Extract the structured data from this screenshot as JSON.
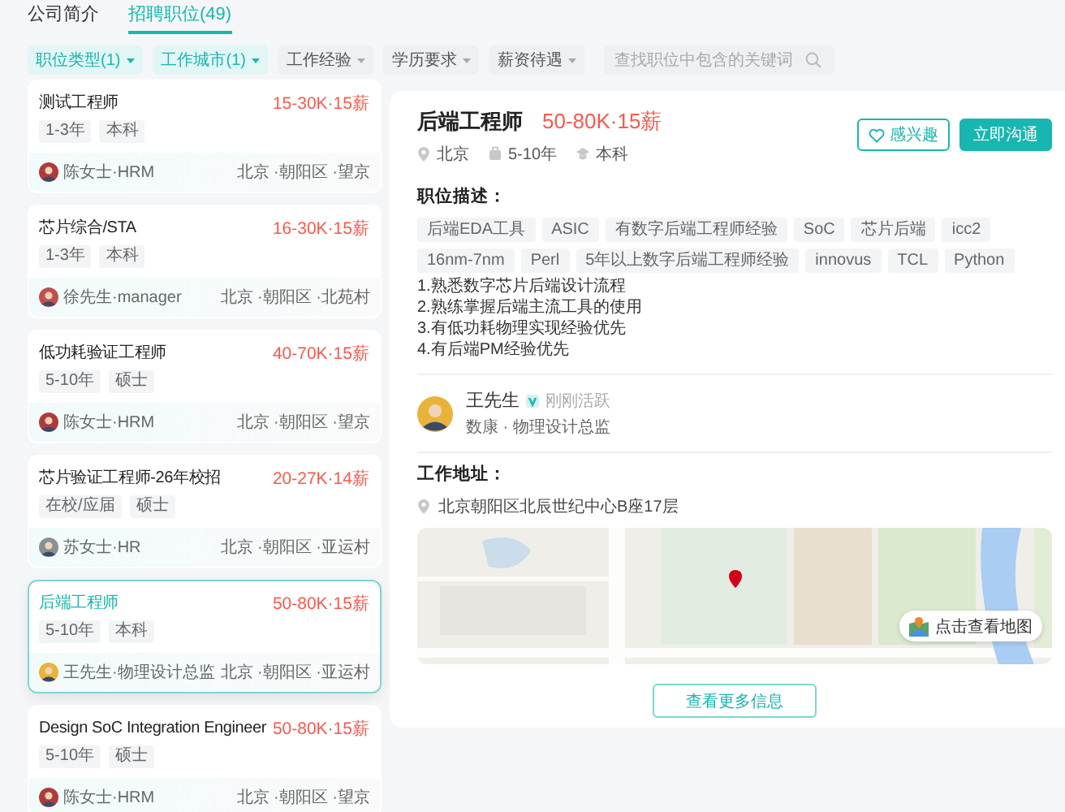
{
  "tabs": [
    {
      "label": "公司简介",
      "selected": false
    },
    {
      "label": "招聘职位(49)",
      "selected": true
    }
  ],
  "filters": [
    {
      "label": "职位类型(1)",
      "selected": true
    },
    {
      "label": "工作城市(1)",
      "selected": true
    },
    {
      "label": "工作经验",
      "selected": false
    },
    {
      "label": "学历要求",
      "selected": false
    },
    {
      "label": "薪资待遇",
      "selected": false
    }
  ],
  "search": {
    "placeholder": "查找职位中包含的关键词"
  },
  "jobs": [
    {
      "title": "测试工程师",
      "salary": "15-30K·15薪",
      "tags": [
        "1-3年",
        "本科"
      ],
      "recruiter": "陈女士·HRM",
      "location": "北京 ·朝阳区 ·望京",
      "selected": false
    },
    {
      "title": "芯片综合/STA",
      "salary": "16-30K·15薪",
      "tags": [
        "1-3年",
        "本科"
      ],
      "recruiter": "徐先生·manager",
      "location": "北京 ·朝阳区 ·北苑村",
      "selected": false
    },
    {
      "title": "低功耗验证工程师",
      "salary": "40-70K·15薪",
      "tags": [
        "5-10年",
        "硕士"
      ],
      "recruiter": "陈女士·HRM",
      "location": "北京 ·朝阳区 ·望京",
      "selected": false
    },
    {
      "title": "芯片验证工程师-26年校招",
      "salary": "20-27K·14薪",
      "tags": [
        "在校/应届",
        "硕士"
      ],
      "recruiter": "苏女士·HR",
      "location": "北京 ·朝阳区 ·亚运村",
      "selected": false
    },
    {
      "title": "后端工程师",
      "salary": "50-80K·15薪",
      "tags": [
        "5-10年",
        "本科"
      ],
      "recruiter": "王先生·物理设计总监",
      "location": "北京 ·朝阳区 ·亚运村",
      "selected": true
    },
    {
      "title": "Design SoC Integration Engineer",
      "salary": "50-80K·15薪",
      "tags": [
        "5-10年",
        "硕士"
      ],
      "recruiter": "陈女士·HRM",
      "location": "北京 ·朝阳区 ·望京",
      "selected": false
    }
  ],
  "detail": {
    "title": "后端工程师",
    "salary": "50-80K·15薪",
    "meta": [
      {
        "kind": "location",
        "text": "北京"
      },
      {
        "kind": "experience",
        "text": "5-10年"
      },
      {
        "kind": "education",
        "text": "本科"
      }
    ],
    "interest_button": "感兴趣",
    "chat_button": "立即沟通",
    "description_heading": "职位描述：",
    "skills": [
      "后端EDA工具",
      "ASIC",
      "有数字后端工程师经验",
      "SoC",
      "芯片后端",
      "icc2",
      "16nm-7nm",
      "Perl",
      "5年以上数字后端工程师经验",
      "innovus",
      "TCL",
      "Python"
    ],
    "requirements": [
      "1.熟悉数字芯片后端设计流程",
      "2.熟练掌握后端主流工具的使用",
      "3.有低功耗物理实现经验优先",
      "4.有后端PM经验优先"
    ],
    "recruiter": {
      "name": "王先生",
      "status": "刚刚活跃",
      "position": "数康 · 物理设计总监"
    },
    "address_heading": "工作地址：",
    "address": "北京朝阳区北辰世纪中心B座17层",
    "map_button": "点击查看地图",
    "more_button": "查看更多信息"
  }
}
